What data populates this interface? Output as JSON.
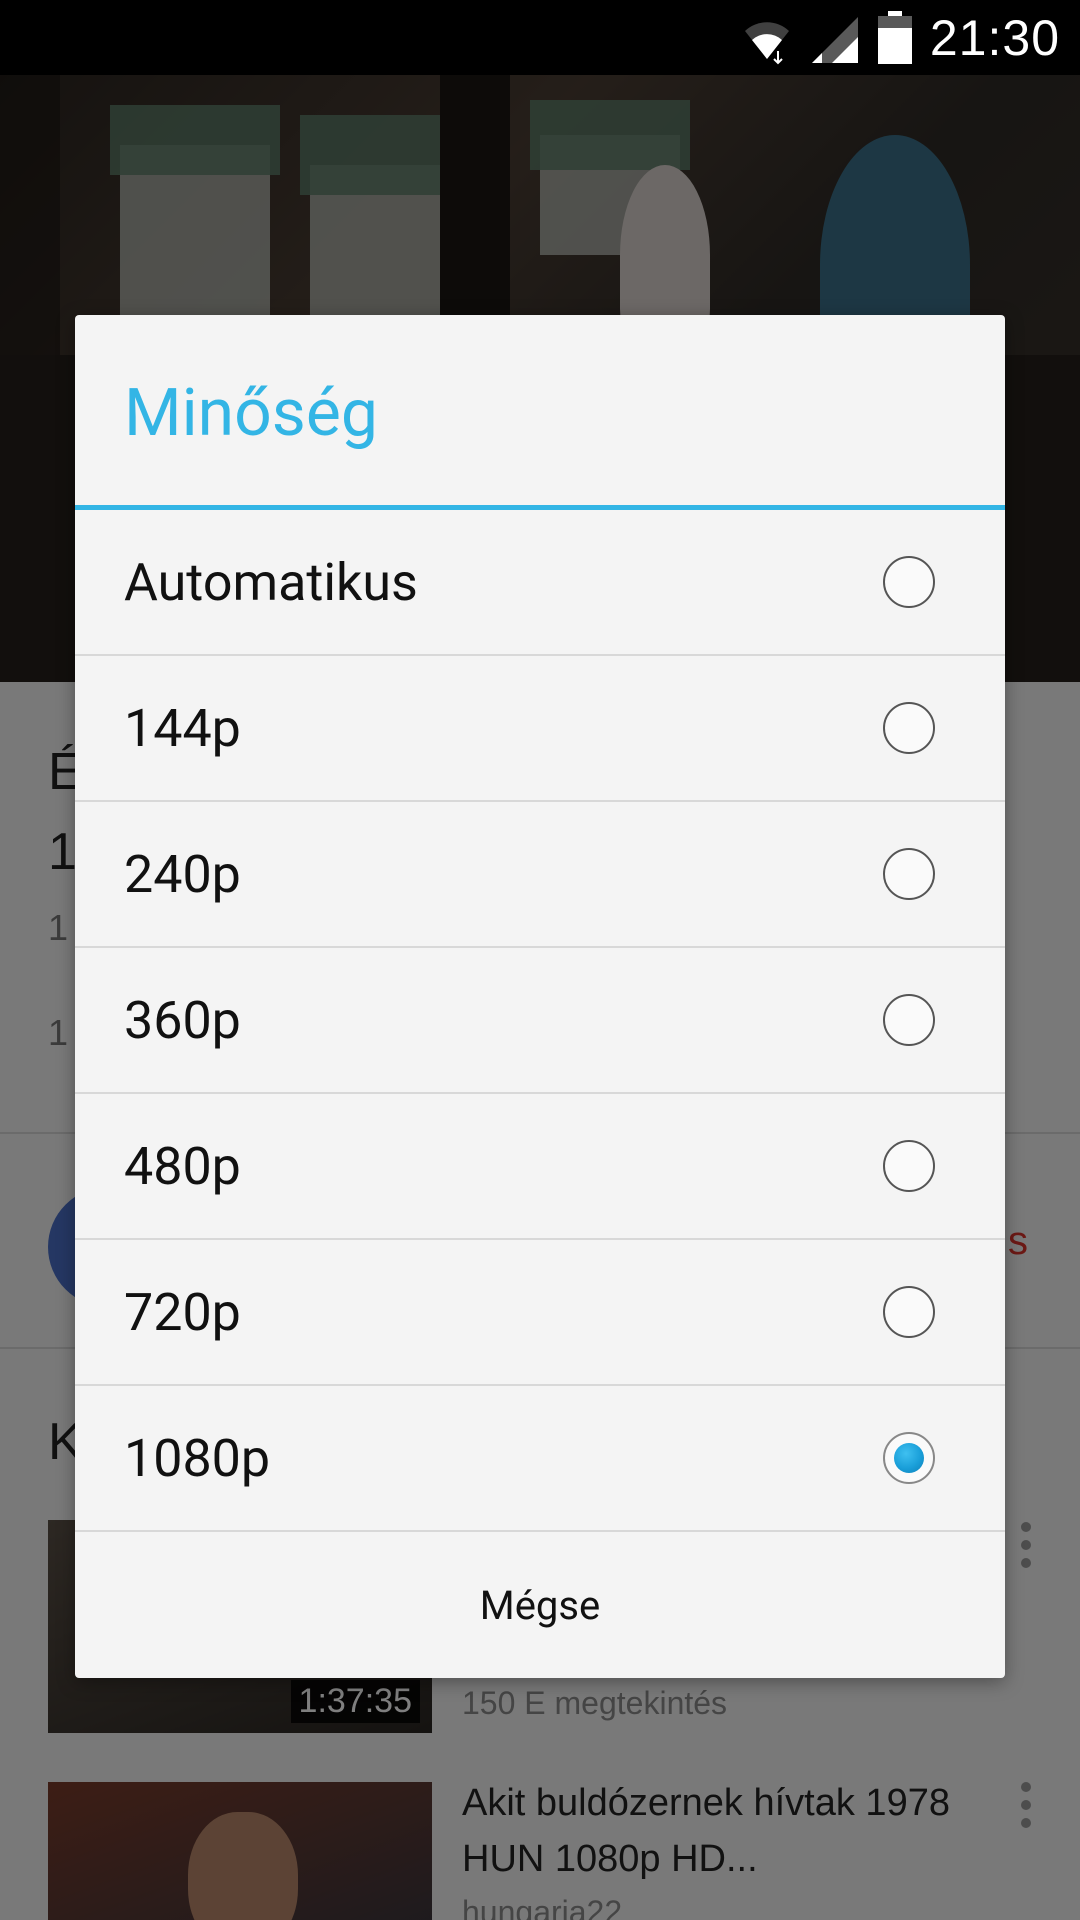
{
  "status_bar": {
    "time": "21:30",
    "icons": [
      "wifi-icon",
      "signal-icon",
      "battery-icon"
    ]
  },
  "background_page": {
    "title_fragment_1": "É",
    "title_fragment_2": "1",
    "meta_fragment_1": "1",
    "meta_fragment_2": "1",
    "subscribe_fragment": "s",
    "section_fragment": "K",
    "videos": [
      {
        "duration": "1:37:35",
        "title_line": "",
        "meta": "150 E megtekintés"
      },
      {
        "duration": "",
        "title_line": "Akit buldózernek hívtak 1978 HUN 1080p HD...",
        "meta": "hungaria22"
      }
    ]
  },
  "dialog": {
    "title": "Minőség",
    "options": [
      {
        "label": "Automatikus",
        "selected": false
      },
      {
        "label": "144p",
        "selected": false
      },
      {
        "label": "240p",
        "selected": false
      },
      {
        "label": "360p",
        "selected": false
      },
      {
        "label": "480p",
        "selected": false
      },
      {
        "label": "720p",
        "selected": false
      },
      {
        "label": "1080p",
        "selected": true
      }
    ],
    "cancel_label": "Mégse"
  },
  "colors": {
    "accent": "#33b5e5",
    "status_bar": "#000000",
    "dialog_bg": "#f4f4f4",
    "subscribe_red": "#d9332a"
  }
}
